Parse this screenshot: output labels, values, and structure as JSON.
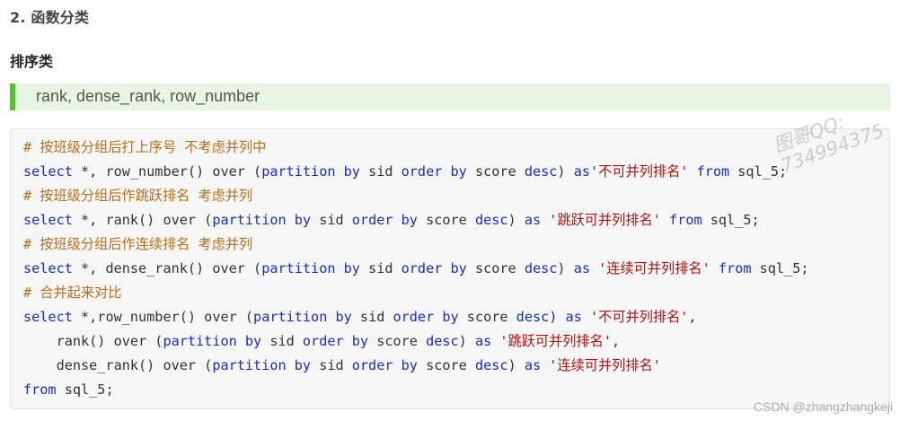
{
  "section_heading": "2. 函数分类",
  "subheading": "排序类",
  "quote_text": "rank, dense_rank, row_number",
  "code_lines": [
    [
      {
        "t": "cm",
        "v": "# 按班级分组后打上序号 不考虑并列中"
      }
    ],
    [
      {
        "t": "kw",
        "v": "select"
      },
      {
        "t": "pl",
        "v": " *, row_number() over ("
      },
      {
        "t": "kw",
        "v": "partition by"
      },
      {
        "t": "pl",
        "v": " sid "
      },
      {
        "t": "kw",
        "v": "order by"
      },
      {
        "t": "pl",
        "v": " score "
      },
      {
        "t": "kw",
        "v": "desc"
      },
      {
        "t": "pl",
        "v": ") "
      },
      {
        "t": "kw",
        "v": "as"
      },
      {
        "t": "st",
        "v": "'不可并列排名'"
      },
      {
        "t": "pl",
        "v": " "
      },
      {
        "t": "kw",
        "v": "from"
      },
      {
        "t": "pl",
        "v": " sql_5;"
      }
    ],
    [
      {
        "t": "cm",
        "v": "# 按班级分组后作跳跃排名 考虑并列"
      }
    ],
    [
      {
        "t": "kw",
        "v": "select"
      },
      {
        "t": "pl",
        "v": " *, rank() over ("
      },
      {
        "t": "kw",
        "v": "partition by"
      },
      {
        "t": "pl",
        "v": " sid "
      },
      {
        "t": "kw",
        "v": "order by"
      },
      {
        "t": "pl",
        "v": " score "
      },
      {
        "t": "kw",
        "v": "desc"
      },
      {
        "t": "pl",
        "v": ") "
      },
      {
        "t": "kw",
        "v": "as"
      },
      {
        "t": "pl",
        "v": " "
      },
      {
        "t": "st",
        "v": "'跳跃可并列排名'"
      },
      {
        "t": "pl",
        "v": " "
      },
      {
        "t": "kw",
        "v": "from"
      },
      {
        "t": "pl",
        "v": " sql_5;"
      }
    ],
    [
      {
        "t": "cm",
        "v": "# 按班级分组后作连续排名 考虑并列"
      }
    ],
    [
      {
        "t": "kw",
        "v": "select"
      },
      {
        "t": "pl",
        "v": " *, dense_rank() over ("
      },
      {
        "t": "kw",
        "v": "partition by"
      },
      {
        "t": "pl",
        "v": " sid "
      },
      {
        "t": "kw",
        "v": "order by"
      },
      {
        "t": "pl",
        "v": " score "
      },
      {
        "t": "kw",
        "v": "desc"
      },
      {
        "t": "pl",
        "v": ") "
      },
      {
        "t": "kw",
        "v": "as"
      },
      {
        "t": "pl",
        "v": " "
      },
      {
        "t": "st",
        "v": "'连续可并列排名'"
      },
      {
        "t": "pl",
        "v": " "
      },
      {
        "t": "kw",
        "v": "from"
      },
      {
        "t": "pl",
        "v": " sql_5;"
      }
    ],
    [
      {
        "t": "cm",
        "v": "# 合并起来对比"
      }
    ],
    [
      {
        "t": "kw",
        "v": "select"
      },
      {
        "t": "pl",
        "v": " *,row_number() over ("
      },
      {
        "t": "kw",
        "v": "partition by"
      },
      {
        "t": "pl",
        "v": " sid "
      },
      {
        "t": "kw",
        "v": "order by"
      },
      {
        "t": "pl",
        "v": " score "
      },
      {
        "t": "kw",
        "v": "desc"
      },
      {
        "t": "pl",
        "v": ") "
      },
      {
        "t": "kw",
        "v": "as"
      },
      {
        "t": "pl",
        "v": " "
      },
      {
        "t": "st",
        "v": "'不可并列排名'"
      },
      {
        "t": "pl",
        "v": ","
      }
    ],
    [
      {
        "t": "pl",
        "v": "    rank() over ("
      },
      {
        "t": "kw",
        "v": "partition by"
      },
      {
        "t": "pl",
        "v": " sid "
      },
      {
        "t": "kw",
        "v": "order by"
      },
      {
        "t": "pl",
        "v": " score "
      },
      {
        "t": "kw",
        "v": "desc"
      },
      {
        "t": "pl",
        "v": ") "
      },
      {
        "t": "kw",
        "v": "as"
      },
      {
        "t": "pl",
        "v": " "
      },
      {
        "t": "st",
        "v": "'跳跃可并列排名'"
      },
      {
        "t": "pl",
        "v": ","
      }
    ],
    [
      {
        "t": "pl",
        "v": "    dense_rank() over ("
      },
      {
        "t": "kw",
        "v": "partition by"
      },
      {
        "t": "pl",
        "v": " sid "
      },
      {
        "t": "kw",
        "v": "order by"
      },
      {
        "t": "pl",
        "v": " score "
      },
      {
        "t": "kw",
        "v": "desc"
      },
      {
        "t": "pl",
        "v": ") "
      },
      {
        "t": "kw",
        "v": "as"
      },
      {
        "t": "pl",
        "v": " "
      },
      {
        "t": "st",
        "v": "'连续可并列排名'"
      }
    ],
    [
      {
        "t": "kw",
        "v": "from"
      },
      {
        "t": "pl",
        "v": " sql_5;"
      }
    ]
  ],
  "watermark_lines": [
    "图哥QQ:",
    "734994375"
  ],
  "footer_watermark": "CSDN @zhangzhangkeji",
  "colors": {
    "comment": "#b1701b",
    "keyword": "#1d2cb8",
    "string": "#a31515",
    "quote_bar": "#55c12f",
    "quote_bg": "#e7f6e2"
  }
}
